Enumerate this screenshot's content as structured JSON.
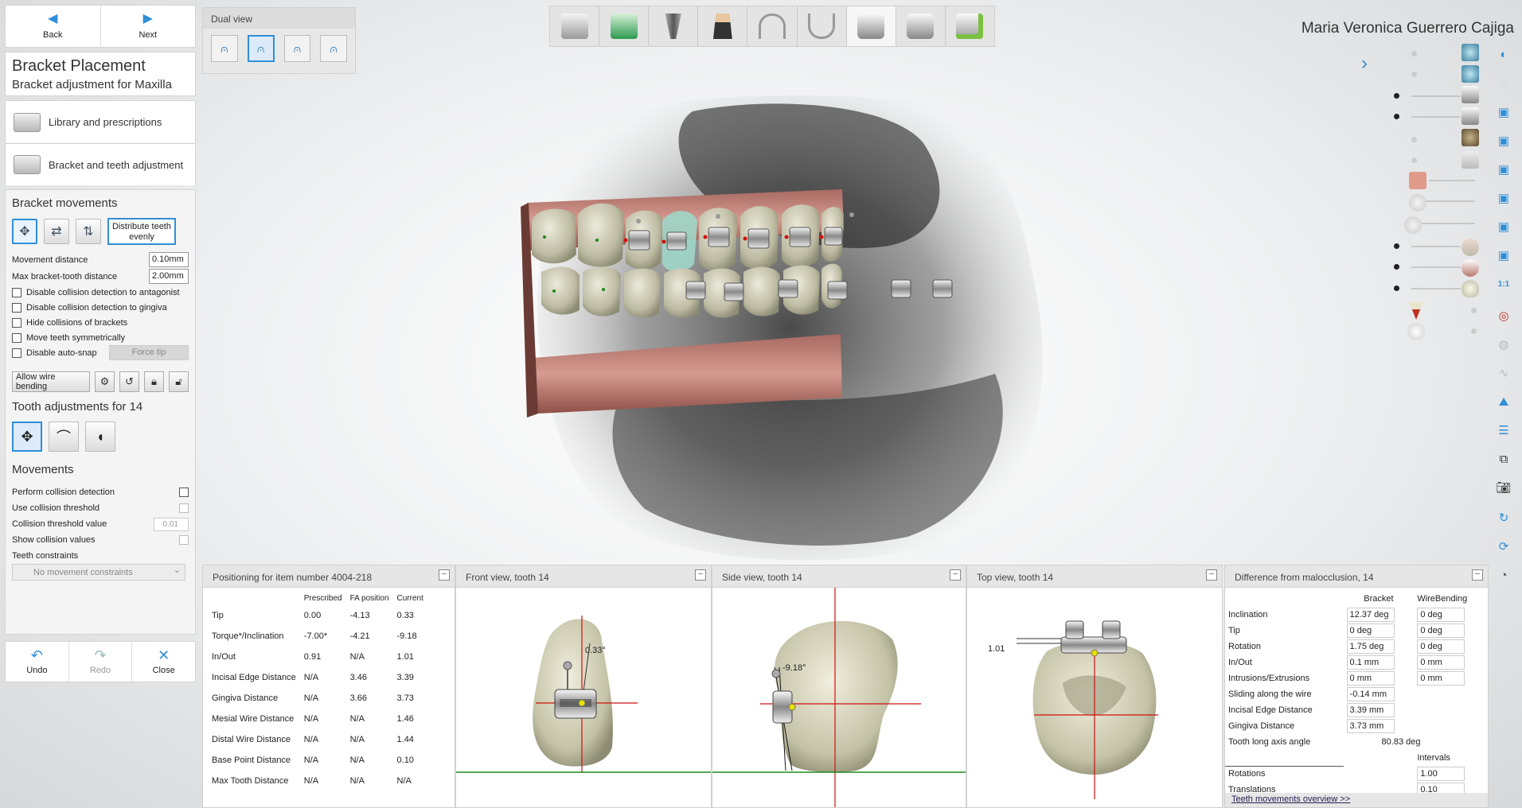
{
  "nav": {
    "back_label": "Back",
    "next_label": "Next"
  },
  "title": {
    "main": "Bracket Placement",
    "sub": "Bracket adjustment for Maxilla"
  },
  "steps": [
    {
      "label": "Library and prescriptions"
    },
    {
      "label": "Bracket and teeth adjustment"
    }
  ],
  "bracket_movements": {
    "heading": "Bracket movements",
    "distribute_label": "Distribute teeth evenly",
    "movement_distance_label": "Movement distance",
    "movement_distance_value": "0.10mm",
    "max_distance_label": "Max bracket-tooth distance",
    "max_distance_value": "2.00mm",
    "checkboxes": [
      "Disable collision detection to antagonist",
      "Disable collision detection to gingiva",
      "Hide collisions of brackets",
      "Move teeth symmetrically",
      "Disable auto-snap"
    ],
    "force_tip_label": "Force tip",
    "wire_bending_label": "Allow wire bending"
  },
  "tooth_adjustments": {
    "heading": "Tooth adjustments for 14"
  },
  "movements": {
    "heading": "Movements",
    "perform_collision": "Perform collision detection",
    "use_threshold": "Use collision threshold",
    "threshold_value_label": "Collision threshold value",
    "threshold_value": "0.01",
    "show_collision": "Show collision values",
    "teeth_constraints": "Teeth constraints",
    "constraint_select": "No movement constraints"
  },
  "actions": {
    "undo": "Undo",
    "redo": "Redo",
    "close": "Close"
  },
  "dual_view": {
    "title": "Dual view"
  },
  "patient_name": "Maria Veronica Guerrero Cajiga",
  "positioning": {
    "title": "Positioning for item number 4004-218",
    "columns": [
      "",
      "Prescribed",
      "FA position",
      "Current"
    ],
    "rows": [
      [
        "Tip",
        "0.00",
        "-4.13",
        "0.33"
      ],
      [
        "Torque*/Inclination",
        "-7.00*",
        "-4.21",
        "-9.18"
      ],
      [
        "In/Out",
        "0.91",
        "N/A",
        "1.01"
      ],
      [
        "Incisal Edge Distance",
        "N/A",
        "3.46",
        "3.39"
      ],
      [
        "Gingiva Distance",
        "N/A",
        "3.66",
        "3.73"
      ],
      [
        "Mesial Wire Distance",
        "N/A",
        "N/A",
        "1.46"
      ],
      [
        "Distal Wire Distance",
        "N/A",
        "N/A",
        "1.44"
      ],
      [
        "Base Point Distance",
        "N/A",
        "N/A",
        "0.10"
      ],
      [
        "Max Tooth Distance",
        "N/A",
        "N/A",
        "N/A"
      ]
    ]
  },
  "front_view": {
    "title": "Front view, tooth 14",
    "angle_label": "0.33°"
  },
  "side_view": {
    "title": "Side view, tooth 14",
    "angle_label": "-9.18°"
  },
  "top_view": {
    "title": "Top view, tooth 14",
    "distance_label": "1.01"
  },
  "difference": {
    "title": "Difference from malocclusion, 14",
    "col_bracket": "Bracket",
    "col_wire": "WireBending",
    "rows": [
      {
        "label": "Inclination",
        "bracket": "12.37 deg",
        "wire": "0 deg"
      },
      {
        "label": "Tip",
        "bracket": "0 deg",
        "wire": "0 deg"
      },
      {
        "label": "Rotation",
        "bracket": "1.75 deg",
        "wire": "0 deg"
      },
      {
        "label": "In/Out",
        "bracket": "0.1 mm",
        "wire": "0 mm"
      },
      {
        "label": "Intrusions/Extrusions",
        "bracket": "0 mm",
        "wire": "0 mm"
      },
      {
        "label": "Sliding along the wire",
        "bracket": "-0.14 mm",
        "wire": ""
      },
      {
        "label": "Incisal Edge Distance",
        "bracket": "3.39 mm",
        "wire": ""
      },
      {
        "label": "Gingiva Distance",
        "bracket": "3.73 mm",
        "wire": ""
      }
    ],
    "long_axis_label": "Tooth long axis angle",
    "long_axis_value": "80.83 deg",
    "intervals_label": "Intervals",
    "rotations_label": "Rotations",
    "rotations_value": "1.00",
    "translations_label": "Translations",
    "translations_value": "0.10",
    "overview_link": "Teeth movements overview >>"
  },
  "colors": {
    "accent": "#2f8fd8",
    "gingiva": "#c98a80",
    "tooth": "#cfcdb8",
    "axis": "#d01010",
    "baseline": "#1a8a1a"
  }
}
